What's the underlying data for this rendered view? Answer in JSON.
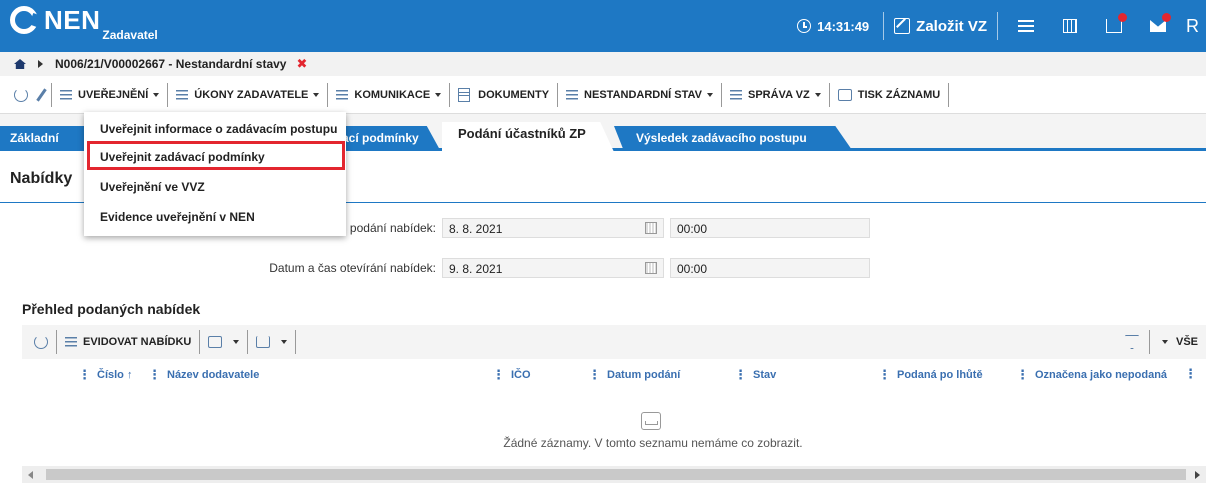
{
  "topbar": {
    "logo_text": "NEN",
    "logo_sub": "Zadavatel",
    "time": "14:31:49",
    "create_label": "Založit VZ",
    "user_initial": "R"
  },
  "breadcrumb": {
    "path": "N006/21/V00002667 - Nestandardní stavy",
    "close": "✖"
  },
  "toolbar": {
    "uverejneni": "UVEŘEJNĚNÍ",
    "ukony": "ÚKONY ZADAVATELE",
    "komunikace": "KOMUNIKACE",
    "dokumenty": "DOKUMENTY",
    "nestandardni": "NESTANDARDNÍ STAV",
    "sprava": "SPRÁVA VZ",
    "tisk": "TISK ZÁZNAMU"
  },
  "tabs": {
    "t1": "Základní",
    "t2": "ací podmínky",
    "active": "Podání účastníků ZP",
    "t4": "Výsledek zadávacího postupu"
  },
  "dropdown": {
    "items": [
      "Uveřejnit informace o zadávacím postupu",
      "Uveřejnit zadávací podmínky",
      "Uveřejnění ve VVZ",
      "Evidence uveřejnění v NEN"
    ]
  },
  "section": {
    "title": "Nabídky"
  },
  "fields": {
    "deadline_label": "podání nabídek:",
    "deadline_date": "8. 8. 2021",
    "deadline_time": "00:00",
    "opening_label": "Datum a čas otevírání nabídek:",
    "opening_date": "9. 8. 2021",
    "opening_time": "00:00"
  },
  "overview": {
    "title": "Přehled podaných nabídek",
    "evidovat": "EVIDOVAT NABÍDKU",
    "filter_all": "VŠE",
    "columns": [
      "Číslo ↑",
      "Název dodavatele",
      "IČO",
      "Datum podání",
      "Stav",
      "Podaná po lhůtě",
      "Označena jako nepodaná"
    ],
    "empty_text": "Žádné záznamy. V tomto seznamu nemáme co zobrazit."
  }
}
